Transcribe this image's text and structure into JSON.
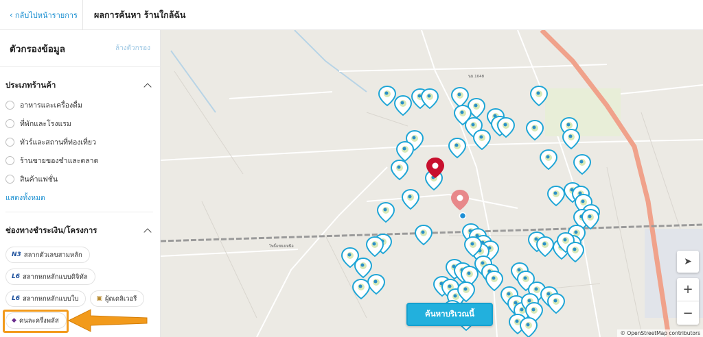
{
  "header": {
    "back_label": "กลับไปหน้ารายการ",
    "title": "ผลการค้นหา ร้านใกล้ฉัน"
  },
  "sidebar": {
    "filter_title": "ตัวกรองข้อมูล",
    "clear_label": "ล้างตัวกรอง",
    "store_type": {
      "title": "ประเภทร้านค้า",
      "items": [
        "อาหารและเครื่องดื่ม",
        "ที่พักและโรงแรม",
        "ทัวร์และสถานที่ท่องเที่ยว",
        "ร้านขายของชำและตลาด",
        "สินค้าแฟชั่น"
      ],
      "show_all": "แสดงทั้งหมด"
    },
    "payment": {
      "title": "ช่องทางชำระเงิน/โครงการ",
      "chips": [
        "สลากตัวเลขสามหลัก",
        "สลากหกหลักแบบดิจิทัล",
        "สลากหกหลักแบบใบ",
        "ผู้ดเดลิเวอรี",
        "คนละครึ่งพลัส"
      ]
    }
  },
  "map": {
    "search_area_label": "ค้นหาบริเวณนี้",
    "attribution": "© OpenStreetMap contributors",
    "road_label": "นม.1048",
    "village_label": "โพธิ์แขยงเหนือ",
    "accent_color": "#22b0dd",
    "pin_red": "#c8102e",
    "pin_pink": "#e8888a"
  }
}
